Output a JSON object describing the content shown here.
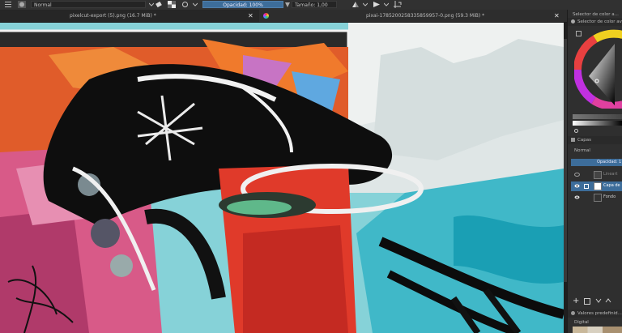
{
  "toolbar": {
    "blend_mode": "Normal",
    "opacity_label": "Opacidad: 100%",
    "size_label": "Tamaño: 1,00 px"
  },
  "tabs": [
    {
      "label": "pixelcut-export (5).png (16.7 MiB) *"
    },
    {
      "label": "pixai-1785200258335859957-0.png (59.3 MiB) *"
    }
  ],
  "dockers": {
    "color_selector_title": "Selector de color a...",
    "color_selector_sub": "Selector de color av...",
    "layers_title": "Capas",
    "layers_blend": "Normal",
    "layers_opacity": "Opacidad: 1",
    "presets_title": "Valores predefinid...",
    "presets_filter": "Digital"
  },
  "layers": [
    {
      "name": "Lineart"
    },
    {
      "name": "Capa de"
    },
    {
      "name": "Fondo"
    }
  ],
  "colors": {
    "accent": "#3d6d9a",
    "brush_preview_from": "#ffffff",
    "brush_preview_to": "#000000"
  }
}
